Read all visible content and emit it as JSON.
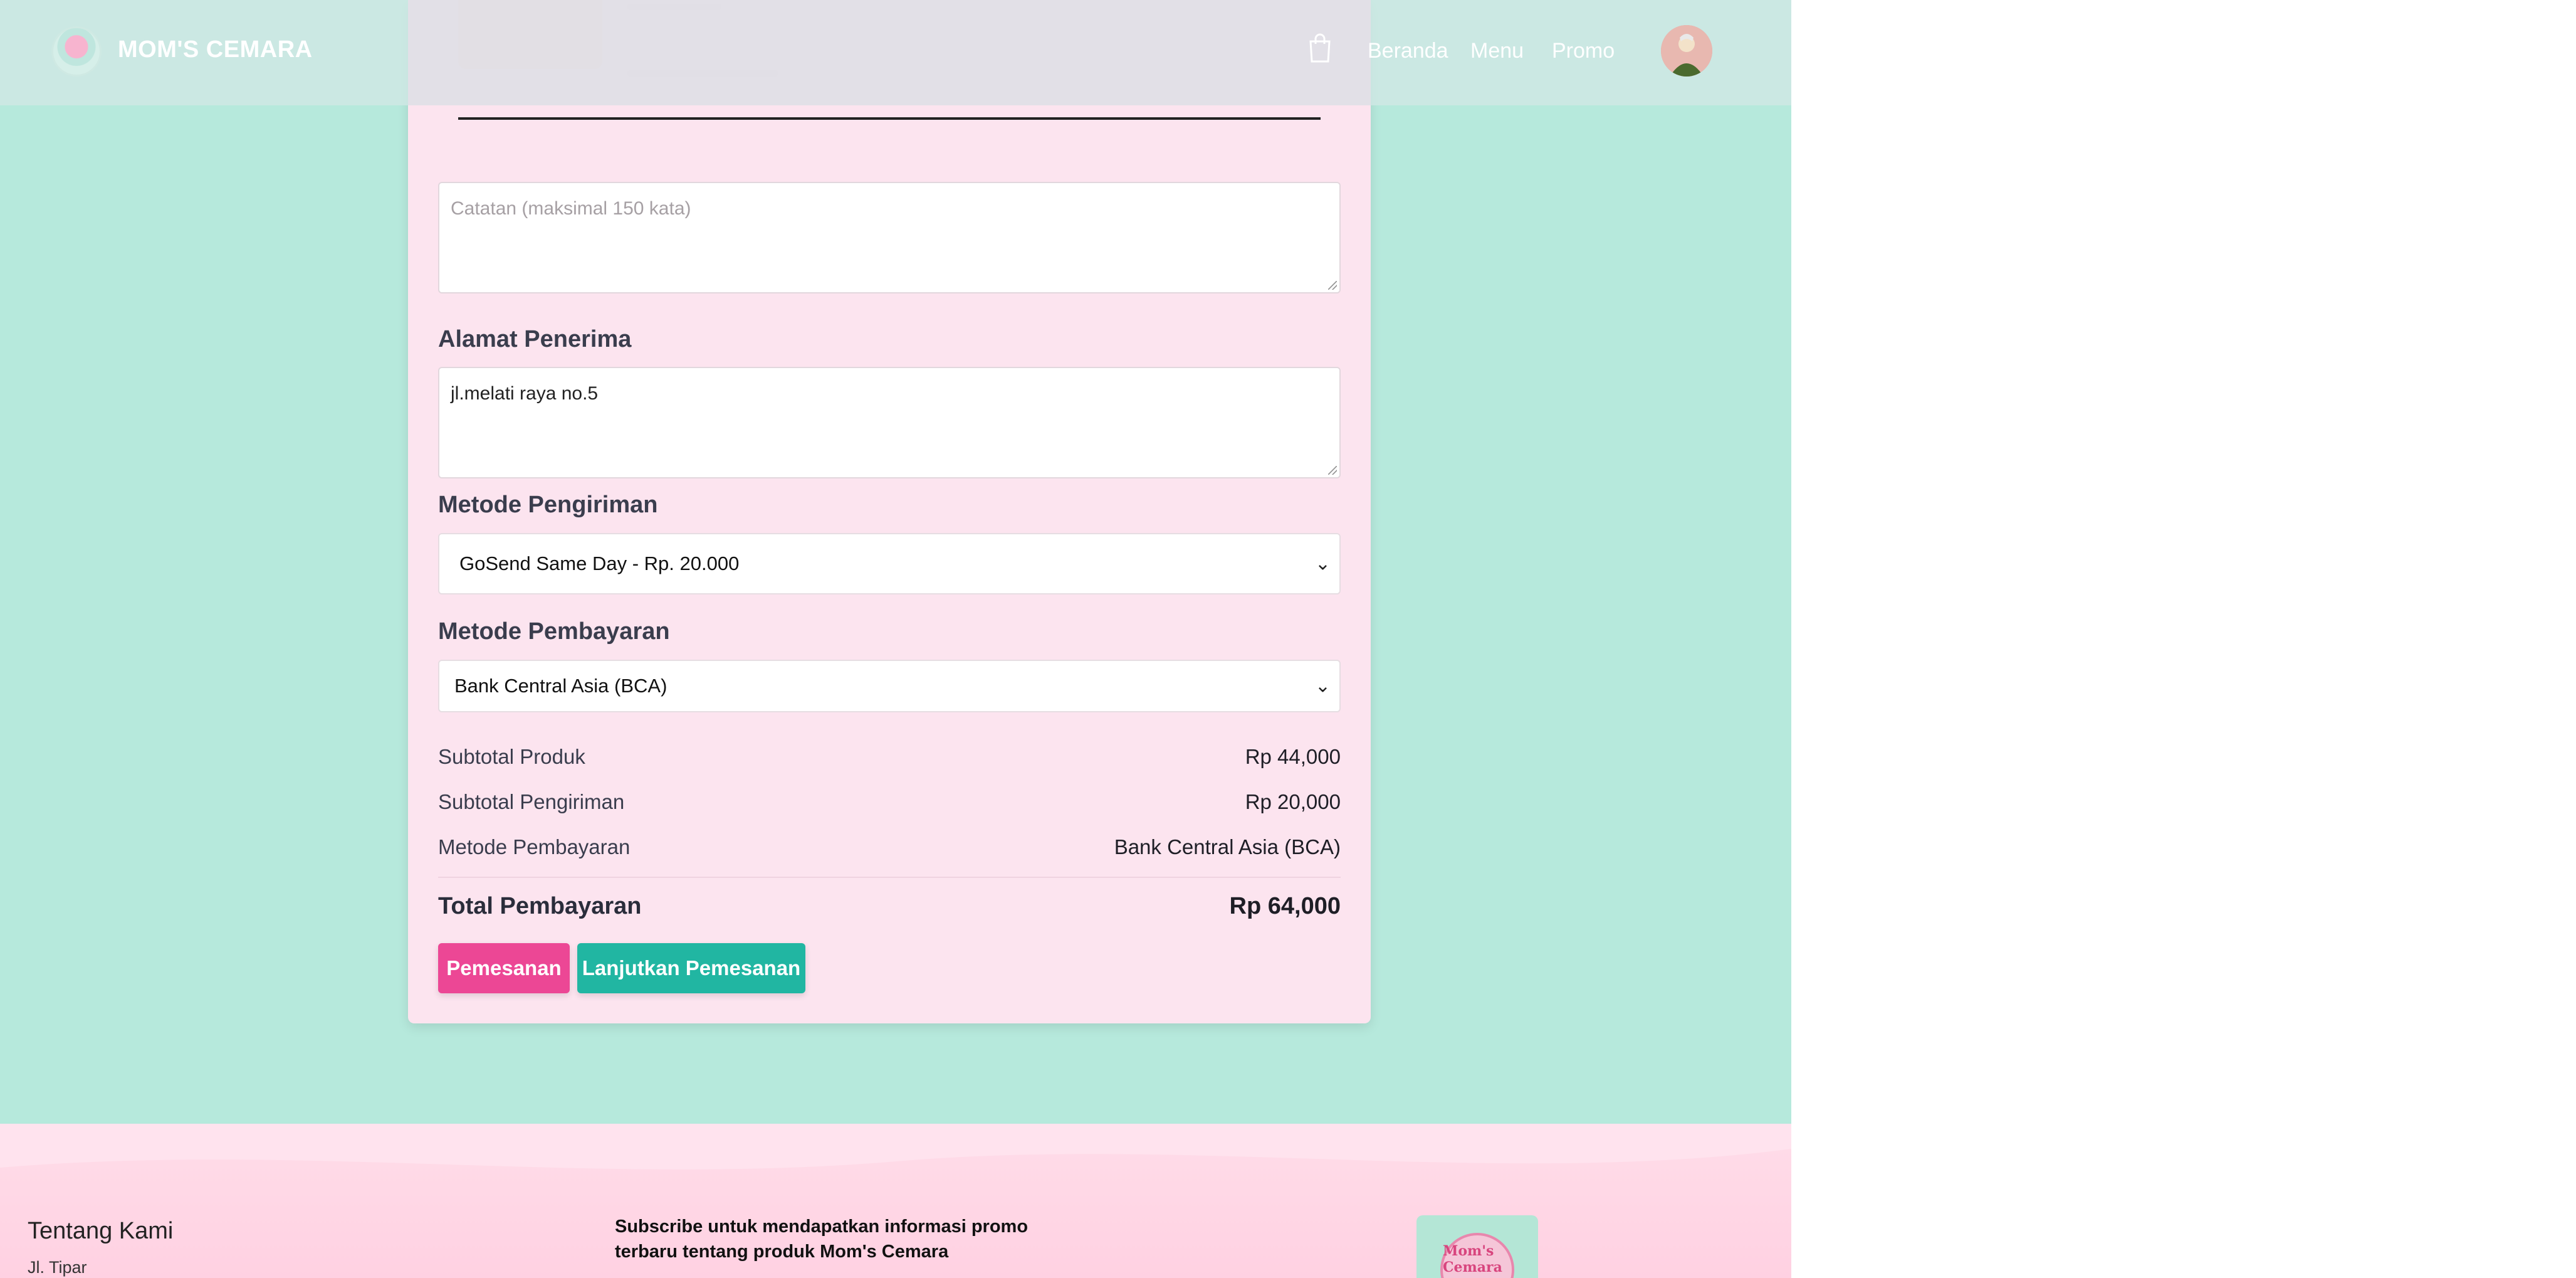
{
  "brand": {
    "name": "MOM'S CEMARA"
  },
  "nav": {
    "links": [
      "Beranda",
      "Menu",
      "Promo"
    ]
  },
  "form": {
    "notes_placeholder": "Catatan (maksimal 150 kata)",
    "address_label": "Alamat Penerima",
    "address_value": "jl.melati raya no.5",
    "shipping_label": "Metode Pengiriman",
    "shipping_selected": "GoSend Same Day - Rp. 20.000",
    "payment_label": "Metode Pembayaran",
    "payment_selected": "Bank Central Asia (BCA)"
  },
  "summary": {
    "rows": [
      {
        "label": "Subtotal Produk",
        "value": "Rp 44,000"
      },
      {
        "label": "Subtotal Pengiriman",
        "value": "Rp 20,000"
      },
      {
        "label": "Metode Pembayaran",
        "value": "Bank Central Asia (BCA)"
      }
    ],
    "total_label": "Total Pembayaran",
    "total_value": "Rp 64,000"
  },
  "actions": {
    "order_button": "Pemesanan",
    "continue_button": "Lanjutkan Pemesanan"
  },
  "footer": {
    "about_title": "Tentang Kami",
    "address": "Jl. Tipar",
    "subscribe_text": "Subscribe untuk mendapatkan informasi promo terbaru tentang produk Mom's Cemara",
    "logo_text": "Mom's Cemara"
  },
  "colors": {
    "background": "#b6e9dc",
    "card": "#fce4ef",
    "primary_pink": "#ec4795",
    "primary_teal": "#21b6a2"
  },
  "icons": {
    "cart": "shopping-bag-icon",
    "avatar": "user-avatar"
  }
}
